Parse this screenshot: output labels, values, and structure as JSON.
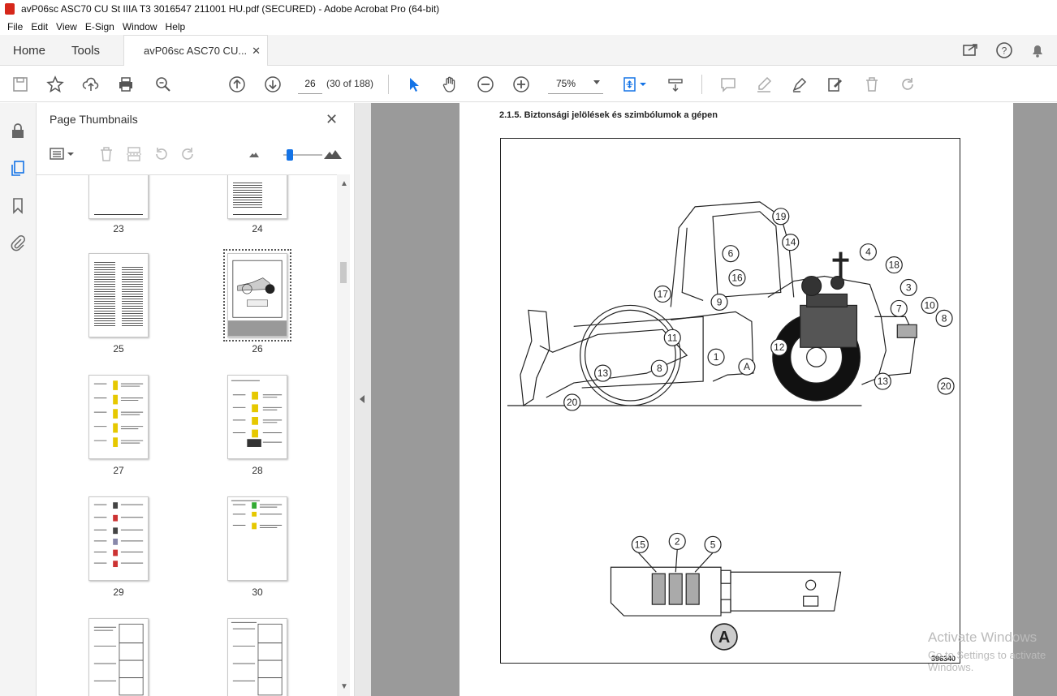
{
  "window": {
    "title": "avP06sc ASC70 CU St IIIA T3 3016547 211001 HU.pdf (SECURED) - Adobe Acrobat Pro (64-bit)"
  },
  "menu": [
    "File",
    "Edit",
    "View",
    "E-Sign",
    "Window",
    "Help"
  ],
  "tabs": {
    "home": "Home",
    "tools": "Tools",
    "doc": "avP06sc ASC70 CU..."
  },
  "toolbar": {
    "page_number": "26",
    "page_count": "(30 of 188)",
    "zoom": "75%"
  },
  "panel": {
    "title": "Page Thumbnails",
    "thumbnails": [
      {
        "label": "23"
      },
      {
        "label": "24"
      },
      {
        "label": "25"
      },
      {
        "label": "26"
      },
      {
        "label": "27"
      },
      {
        "label": "28"
      },
      {
        "label": "29"
      },
      {
        "label": "30"
      }
    ],
    "selected": "26"
  },
  "document": {
    "section_heading": "2.1.5.     Biztonsági jelölések és szimbólumok a gépen",
    "figure_id": "396340",
    "callouts_machine": [
      "19",
      "14",
      "6",
      "16",
      "9",
      "17",
      "4",
      "18",
      "3",
      "7",
      "10",
      "8",
      "11",
      "1",
      "A",
      "12",
      "13",
      "8",
      "20",
      "13",
      "20"
    ],
    "callouts_detail": [
      "15",
      "2",
      "5"
    ],
    "detail_label": "A"
  },
  "overlay": {
    "line1": "Activate Windows",
    "line2": "Go to Settings to activate Windows."
  },
  "colors": {
    "accent": "#1473e6",
    "selection_arrow": "#1473e6"
  }
}
